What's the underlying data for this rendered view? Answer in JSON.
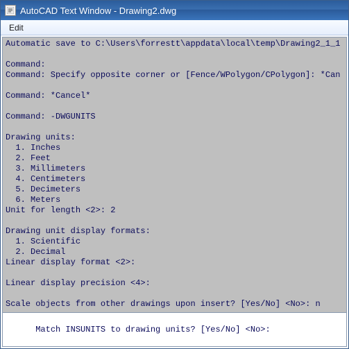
{
  "titlebar": {
    "app_icon": "autocad-text-window-icon",
    "title": "AutoCAD Text Window - Drawing2.dwg"
  },
  "menubar": {
    "items": [
      {
        "label": "Edit"
      }
    ]
  },
  "console": {
    "lines": [
      "Automatic save to C:\\Users\\forrestt\\appdata\\local\\temp\\Drawing2_1_1",
      "",
      "Command:",
      "Command: Specify opposite corner or [Fence/WPolygon/CPolygon]: *Can",
      "",
      "Command: *Cancel*",
      "",
      "Command: -DWGUNITS",
      "",
      "Drawing units:",
      "  1. Inches",
      "  2. Feet",
      "  3. Millimeters",
      "  4. Centimeters",
      "  5. Decimeters",
      "  6. Meters",
      "Unit for length <2>: 2",
      "",
      "Drawing unit display formats:",
      "  1. Scientific",
      "  2. Decimal",
      "Linear display format <2>:",
      "",
      "Linear display precision <4>:",
      "",
      "Scale objects from other drawings upon insert? [Yes/No] <No>: n",
      ""
    ]
  },
  "prompt": {
    "text": "Match INSUNITS to drawing units? [Yes/No] <No>:"
  }
}
